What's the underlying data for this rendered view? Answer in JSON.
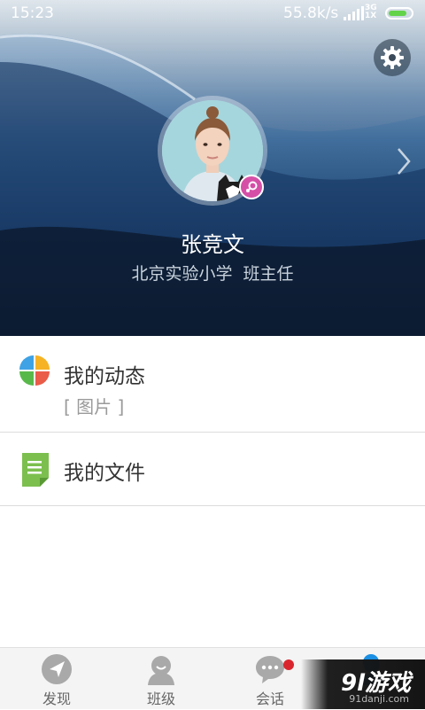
{
  "status_bar": {
    "time": "15:23",
    "speed": "55.8k/s",
    "network_top": "3G",
    "network_bottom": "1X"
  },
  "profile": {
    "name": "张竞文",
    "school": "北京实验小学",
    "role": "班主任",
    "gender": "female"
  },
  "menu": [
    {
      "label": "我的动态",
      "sub": "[ 图片 ]",
      "icon": "pinwheel-icon"
    },
    {
      "label": "我的文件",
      "icon": "document-icon"
    }
  ],
  "bottom_nav": [
    {
      "label": "发现",
      "icon": "compass-icon"
    },
    {
      "label": "班级",
      "icon": "class-icon"
    },
    {
      "label": "会话",
      "icon": "chat-icon"
    },
    {
      "label": "",
      "icon": "me-icon"
    }
  ],
  "watermark": {
    "logo": "9l游戏",
    "url": "91danji.com"
  },
  "colors": {
    "gender_badge": "#d54fa7",
    "unread_dot": "#d9262e",
    "notice_dot": "#1b8fe3",
    "battery": "#63d34a"
  }
}
